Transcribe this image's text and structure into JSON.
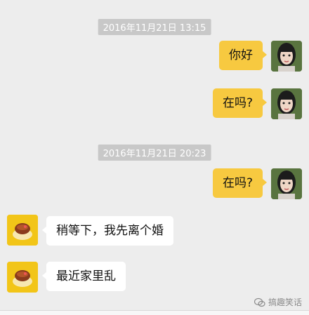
{
  "colors": {
    "background": "#ededed",
    "my_bubble": "#f7c940",
    "their_bubble": "#ffffff",
    "timestamp_bg": "#c8c8c8"
  },
  "timestamps": [
    "2016年11月21日 13:15",
    "2016年11月21日 20:23"
  ],
  "messages": [
    {
      "side": "me",
      "text": "你好",
      "avatar": "girl-avatar"
    },
    {
      "side": "me",
      "text": "在吗?",
      "avatar": "girl-avatar"
    },
    {
      "side": "me",
      "text": "在吗?",
      "avatar": "girl-avatar"
    },
    {
      "side": "them",
      "text": "稍等下，我先离个婚",
      "avatar": "pudding-avatar"
    },
    {
      "side": "them",
      "text": "最近家里乱",
      "avatar": "pudding-avatar"
    }
  ],
  "watermark": "搞趣笑话"
}
